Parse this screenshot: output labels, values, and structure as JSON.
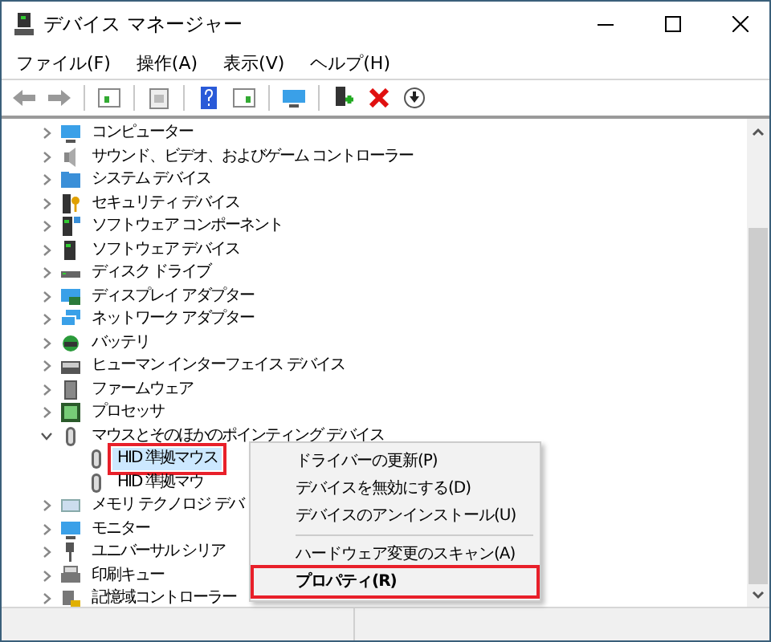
{
  "window": {
    "title": "デバイス マネージャー"
  },
  "menu": [
    "ファイル(F)",
    "操作(A)",
    "表示(V)",
    "ヘルプ(H)"
  ],
  "tree": [
    {
      "label": "コンピューター",
      "expanded": false
    },
    {
      "label": "サウンド、ビデオ、およびゲーム コントローラー",
      "expanded": false
    },
    {
      "label": "システム デバイス",
      "expanded": false
    },
    {
      "label": "セキュリティ デバイス",
      "expanded": false
    },
    {
      "label": "ソフトウェア コンポーネント",
      "expanded": false
    },
    {
      "label": "ソフトウェア デバイス",
      "expanded": false
    },
    {
      "label": "ディスク ドライブ",
      "expanded": false
    },
    {
      "label": "ディスプレイ アダプター",
      "expanded": false
    },
    {
      "label": "ネットワーク アダプター",
      "expanded": false
    },
    {
      "label": "バッテリ",
      "expanded": false
    },
    {
      "label": "ヒューマン インターフェイス デバイス",
      "expanded": false
    },
    {
      "label": "ファームウェア",
      "expanded": false
    },
    {
      "label": "プロセッサ",
      "expanded": false
    },
    {
      "label": "マウスとそのほかのポインティング デバイス",
      "expanded": true,
      "children": [
        {
          "label": "HID 準拠マウス",
          "selected": true,
          "outlined": true
        },
        {
          "label": "HID 準拠マウ",
          "selected": false,
          "outlined": false
        }
      ]
    },
    {
      "label": "メモリ テクノロジ デバ",
      "expanded": false
    },
    {
      "label": "モニター",
      "expanded": false
    },
    {
      "label": "ユニバーサル シリア",
      "expanded": false
    },
    {
      "label": "印刷キュー",
      "expanded": false
    },
    {
      "label": "記憶域コントローラー",
      "expanded": false
    }
  ],
  "context_menu": [
    {
      "kind": "item",
      "label": "ドライバーの更新(P)",
      "bold": false,
      "outlined": false
    },
    {
      "kind": "item",
      "label": "デバイスを無効にする(D)",
      "bold": false,
      "outlined": false
    },
    {
      "kind": "item",
      "label": "デバイスのアンインストール(U)",
      "bold": false,
      "outlined": false
    },
    {
      "kind": "separator"
    },
    {
      "kind": "item",
      "label": "ハードウェア変更のスキャン(A)",
      "bold": false,
      "outlined": false
    },
    {
      "kind": "item",
      "label": "プロパティ(R)",
      "bold": true,
      "outlined": true
    }
  ]
}
